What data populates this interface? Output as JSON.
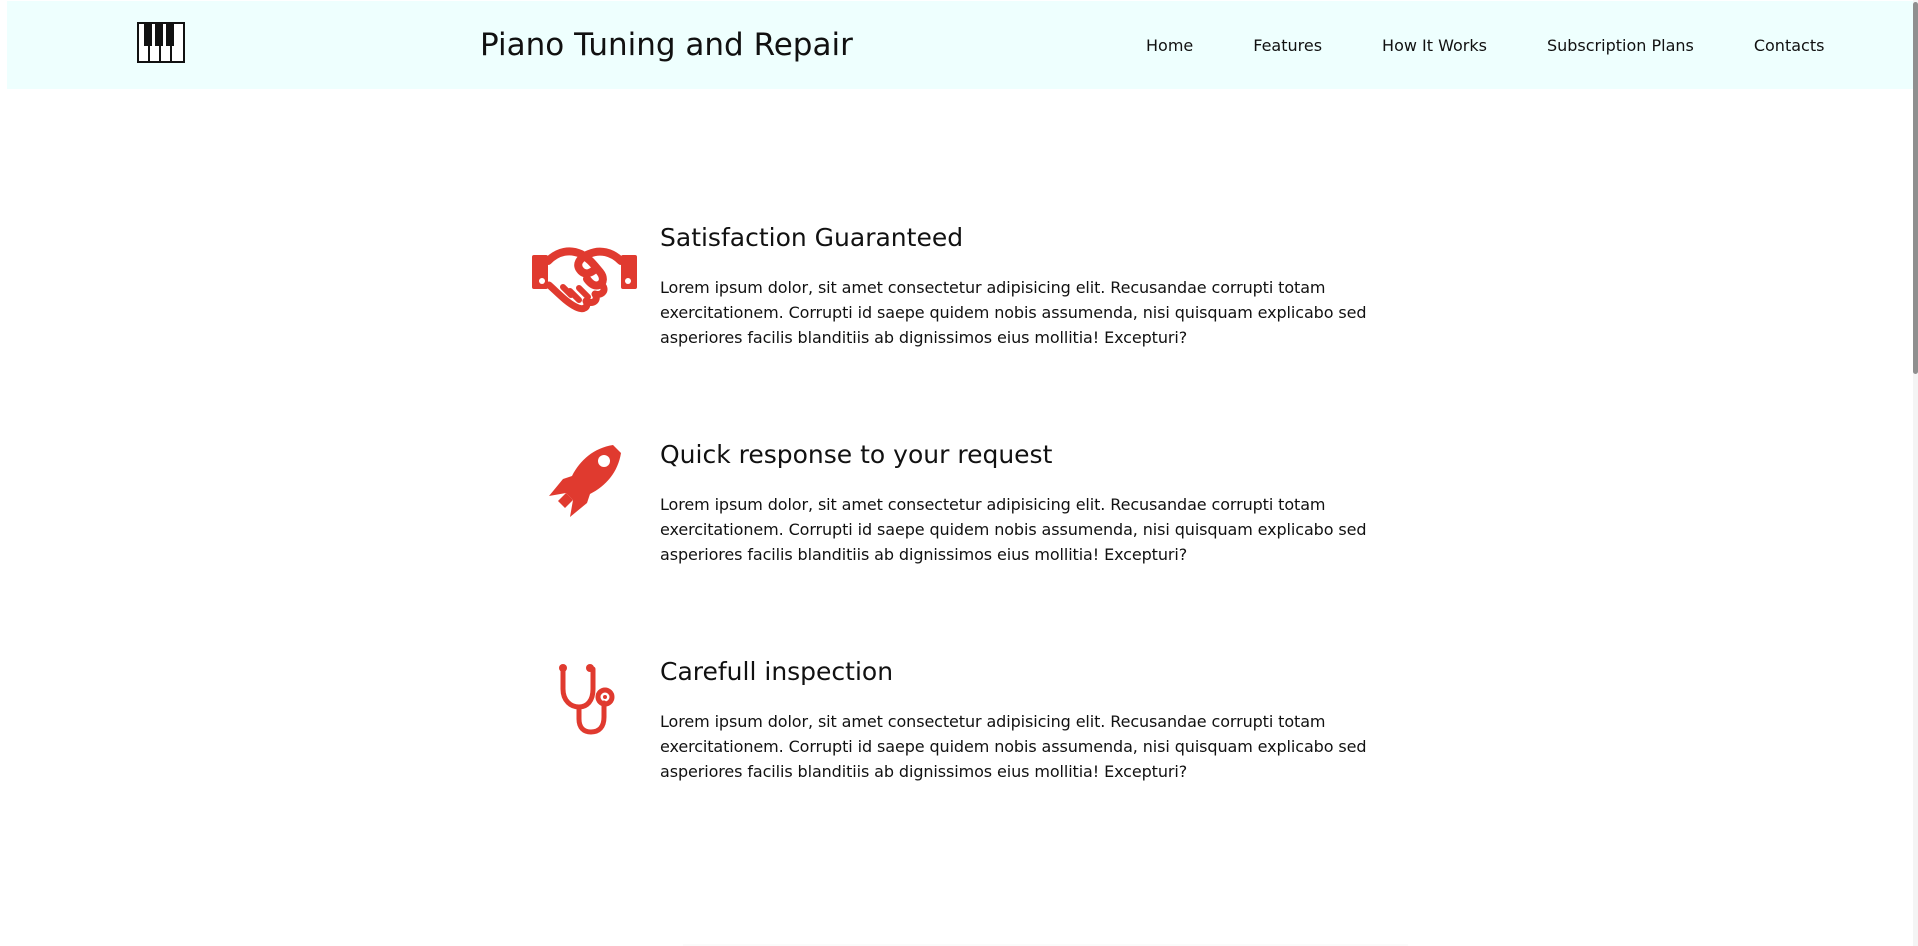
{
  "header": {
    "title": "Piano Tuning and Repair",
    "logo_icon": "piano-keys-icon",
    "nav": [
      {
        "label": "Home"
      },
      {
        "label": "Features"
      },
      {
        "label": "How It Works"
      },
      {
        "label": "Subscription Plans"
      },
      {
        "label": "Contacts"
      }
    ]
  },
  "features": [
    {
      "icon": "handshake-icon",
      "title": "Satisfaction Guaranteed",
      "text": "Lorem ipsum dolor, sit amet consectetur adipisicing elit. Recusandae corrupti totam exercitationem. Corrupti id saepe quidem nobis assumenda, nisi quisquam explicabo sed asperiores facilis blanditiis ab dignissimos eius mollitia! Excepturi?"
    },
    {
      "icon": "rocket-icon",
      "title": "Quick response to your request",
      "text": "Lorem ipsum dolor, sit amet consectetur adipisicing elit. Recusandae corrupti totam exercitationem. Corrupti id saepe quidem nobis assumenda, nisi quisquam explicabo sed asperiores facilis blanditiis ab dignissimos eius mollitia! Excepturi?"
    },
    {
      "icon": "stethoscope-icon",
      "title": "Carefull inspection",
      "text": "Lorem ipsum dolor, sit amet consectetur adipisicing elit. Recusandae corrupti totam exercitationem. Corrupti id saepe quidem nobis assumenda, nisi quisquam explicabo sed asperiores facilis blanditiis ab dignissimos eius mollitia! Excepturi?"
    }
  ],
  "colors": {
    "header_background": "#eefffe",
    "accent": "#e03a2f",
    "text": "#111111"
  }
}
